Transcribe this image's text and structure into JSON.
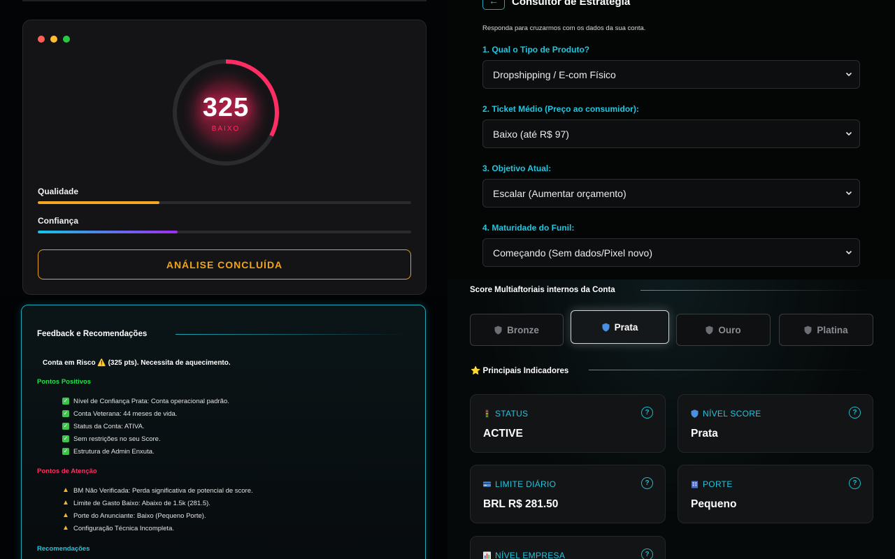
{
  "score": {
    "value": "325",
    "rating": "BAIXO",
    "gauge_fraction": 0.325,
    "colors": {
      "gauge": "#ff2d63",
      "quality": "#f5a623",
      "accent": "#20c7e0"
    },
    "bars": [
      {
        "label": "Qualidade",
        "fraction": 0.325
      },
      {
        "label": "Confiança",
        "fraction": 0.375
      }
    ],
    "done_button": "ANÁLISE CONCLUÍDA"
  },
  "feedback": {
    "title": "Feedback e Recomendações",
    "risk": "Conta em Risco ⚠️ (325 pts). Necessita de aquecimento.",
    "positives_title": "Pontos Positivos",
    "positives": [
      "Nível de Confiança Prata: Conta operacional padrão.",
      "Conta Veterana: 44 meses de vida.",
      "Status da Conta: ATIVA.",
      "Sem restrições no seu Score.",
      "Estrutura de Admin Enxuta."
    ],
    "attention_title": "Pontos de Atenção",
    "attention": [
      "BM Não Verificada: Perda significativa de potencial de score.",
      "Limite de Gasto Baixo: Abaixo de 1.5k (281.5).",
      "Porte do Anunciante: Baixo (Pequeno Porte).",
      "Configuração Técnica Incompleta."
    ],
    "recommendations_title": "Recomendações"
  },
  "strategy": {
    "back": "←",
    "title": "Consultor de Estratégia",
    "subtitle": "Responda para cruzarmos com os dados da sua conta.",
    "questions": [
      {
        "label": "1. Qual o Tipo de Produto?",
        "value": "Dropshipping / E-com Físico"
      },
      {
        "label": "2. Ticket Médio (Preço ao consumidor):",
        "value": "Baixo (até R$ 97)"
      },
      {
        "label": "3. Objetivo Atual:",
        "value": "Escalar (Aumentar orçamento)"
      },
      {
        "label": "4. Maturidade do Funil:",
        "value": "Começando (Sem dados/Pixel novo)"
      }
    ]
  },
  "tiers": {
    "title": "Score Multiaftoriais internos da Conta",
    "items": [
      {
        "label": "Bronze",
        "icon": "shield-icon"
      },
      {
        "label": "Prata",
        "icon": "shield-icon",
        "active": true
      },
      {
        "label": "Ouro",
        "icon": "shield-icon"
      },
      {
        "label": "Platina",
        "icon": "shield-icon"
      }
    ]
  },
  "indicators": {
    "title": "Principais Indicadores",
    "star": "⭐",
    "items": [
      {
        "label": "STATUS",
        "value": "ACTIVE",
        "icon": "traffic-light-icon"
      },
      {
        "label": "NÍVEL SCORE",
        "value": "Prata",
        "icon": "shield-icon"
      },
      {
        "label": "LIMITE DIÁRIO",
        "value": "BRL R$ 281.50",
        "icon": "credit-card-icon"
      },
      {
        "label": "PORTE",
        "value": "Pequeno",
        "icon": "building-icon"
      },
      {
        "label": "NÍVEL EMPRESA",
        "value": "",
        "icon": "bar-chart-icon"
      }
    ],
    "help": "?"
  }
}
